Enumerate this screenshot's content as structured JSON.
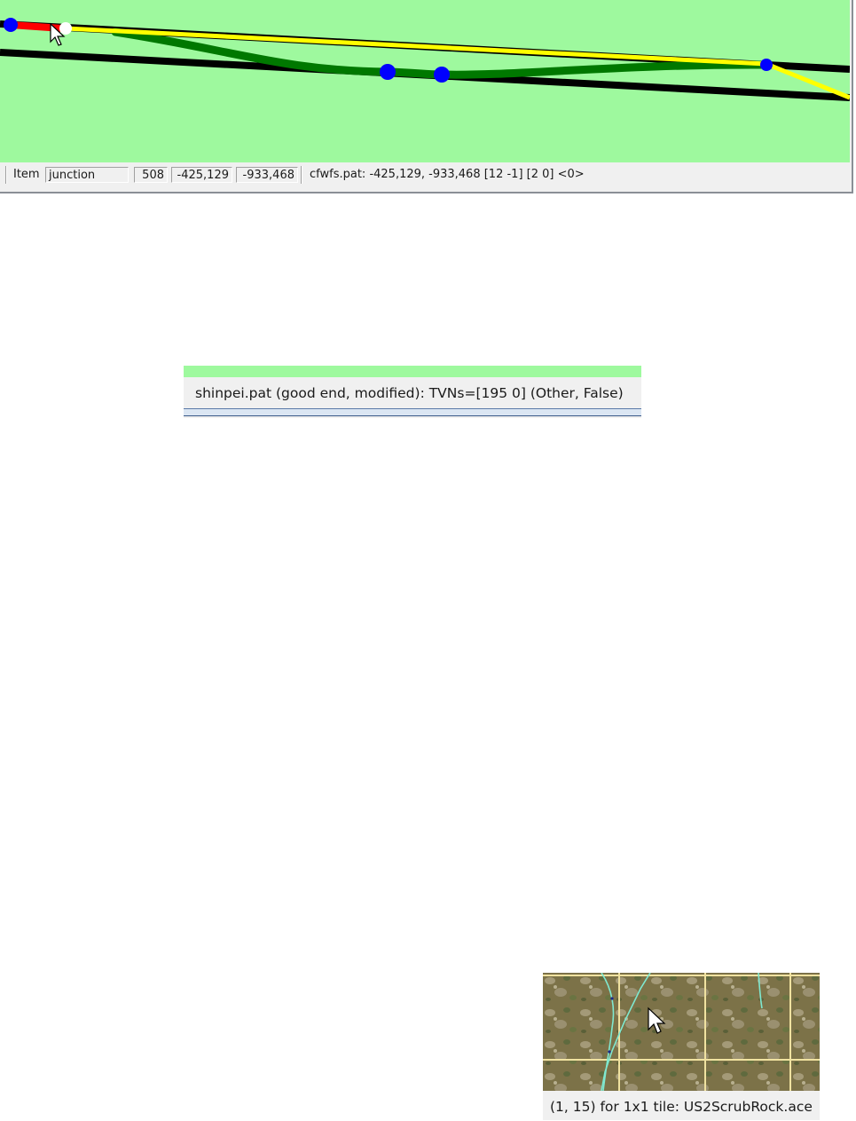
{
  "track_status_bar": {
    "item_label": "Item",
    "item_type": "junction",
    "item_index": "508",
    "coord_x": "-425,129",
    "coord_z": "-933,468",
    "path_info": "cfwfs.pat: -425,129, -933,468 [12 -1] [2 0] <0>"
  },
  "path_status": {
    "text": "shinpei.pat (good end, modified): TVNs=[195 0] (Other, False)"
  },
  "terrain_status": {
    "text": "(1, 15) for 1x1 tile: US2ScrubRock.ace"
  },
  "colors": {
    "canvas_background": "#9ef99e",
    "track": "#000000",
    "selected_path": "#ffff00",
    "siding_path": "#007800",
    "highlighted_segment": "#ff0000",
    "node": "#0000ff",
    "terrain_grid": "#f0e2a0",
    "terrain_track": "#7fe8d0"
  },
  "icons": {
    "track_view_cursor": "mouse-pointer-icon",
    "terrain_view_cursor": "mouse-pointer-icon"
  }
}
